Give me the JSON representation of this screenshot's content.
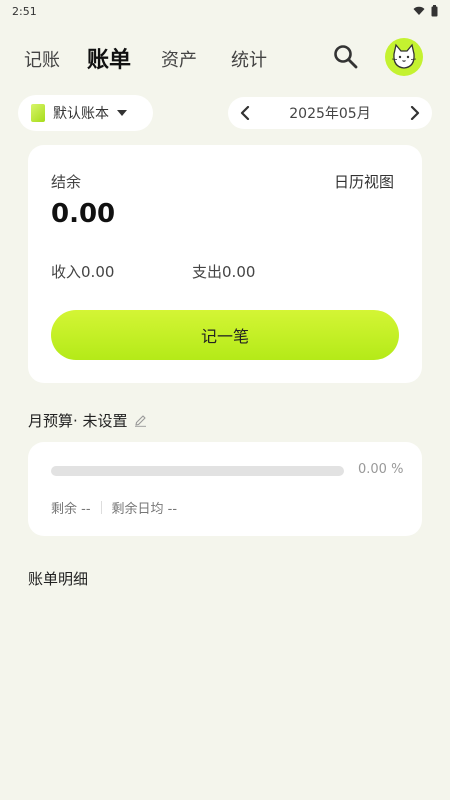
{
  "status": {
    "time": "2:51"
  },
  "nav": {
    "tabs": [
      {
        "label": "记账"
      },
      {
        "label": "账单"
      },
      {
        "label": "资产"
      },
      {
        "label": "统计"
      }
    ],
    "active_index": 1
  },
  "book": {
    "name": "默认账本"
  },
  "month": {
    "label": "2025年05月"
  },
  "summary": {
    "balance_label": "结余",
    "calendar_label": "日历视图",
    "balance_value": "0.00",
    "income_label": "收入",
    "income_value": "0.00",
    "expense_label": "支出",
    "expense_value": "0.00",
    "record_button": "记一笔"
  },
  "budget": {
    "title": "月预算· 未设置",
    "progress": 0,
    "progress_text": "0.00 %",
    "remaining": "剩余 --",
    "daily_remaining": "剩余日均 --"
  },
  "details": {
    "title": "账单明细"
  },
  "colors": {
    "accent": "#b4ea18",
    "background": "#f4f5ec"
  }
}
